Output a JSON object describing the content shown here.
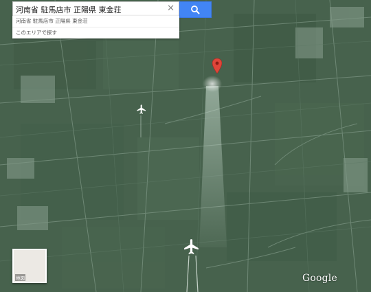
{
  "search": {
    "query": "河南省 駐馬店市 正陽県 東金荘",
    "clear_icon": "close-icon",
    "button_icon": "search-icon",
    "suggestions": [
      "河南省 駐馬店市 正陽県 東金荘",
      "このエリアで探す"
    ]
  },
  "minimap": {
    "label": "地図"
  },
  "branding": {
    "logo_text": "Google"
  },
  "markers": [
    {
      "icon": "map-pin-icon",
      "color": "#e0453a"
    }
  ],
  "planes": [
    {
      "icon": "airplane-icon"
    },
    {
      "icon": "airplane-icon"
    }
  ],
  "colors": {
    "map_base": "#47624d",
    "search_button": "#4285f4",
    "pin": "#e0453a"
  }
}
